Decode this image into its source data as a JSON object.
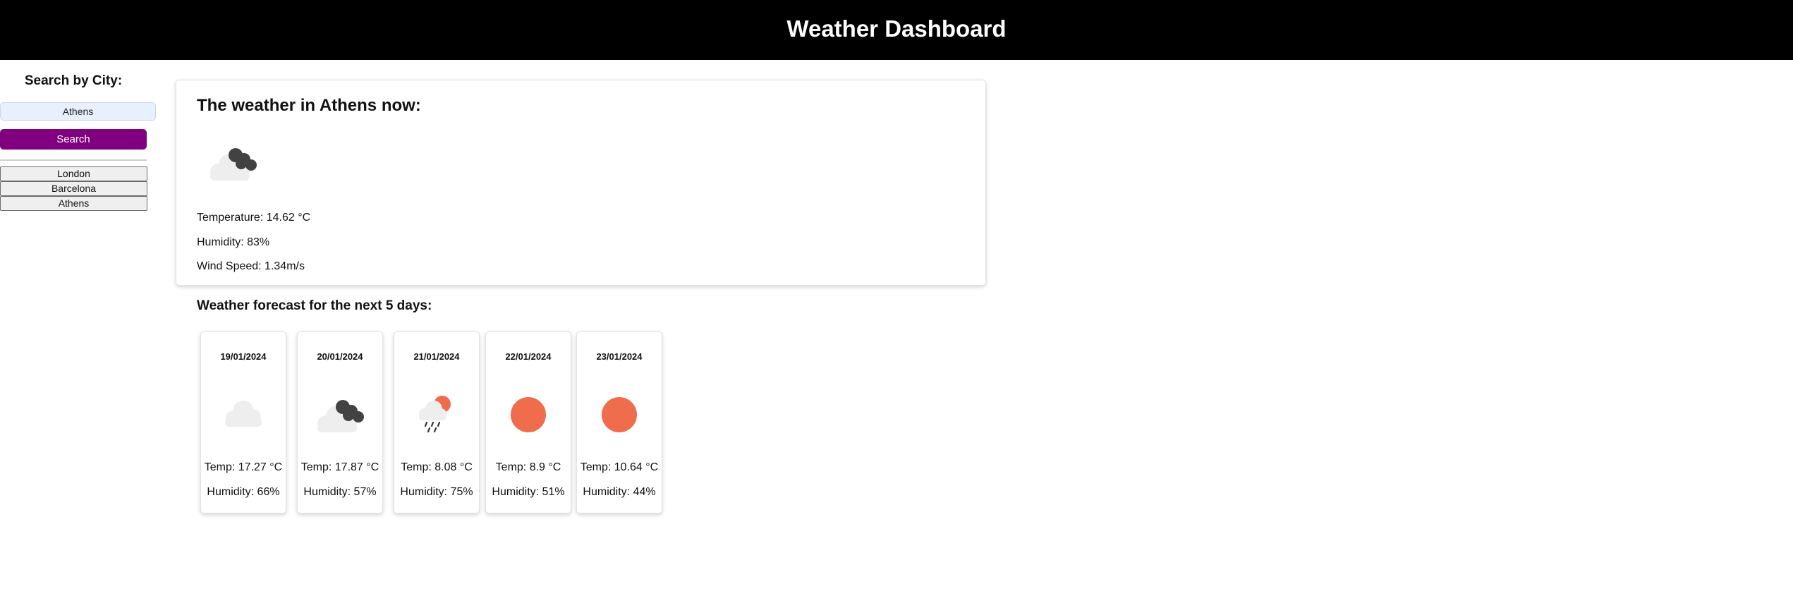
{
  "header": {
    "title": "Weather Dashboard"
  },
  "sidebar": {
    "heading": "Search by City:",
    "search_input_value": "Athens",
    "search_button_label": "Search",
    "history": [
      "London",
      "Barcelona",
      "Athens"
    ]
  },
  "current": {
    "heading": "The weather in Athens now:",
    "icon": "broken-clouds-icon",
    "temperature": "Temperature: 14.62 °C",
    "humidity": "Humidity: 83%",
    "wind": "Wind Speed: 1.34m/s"
  },
  "forecast": {
    "heading": "Weather forecast for the next 5 days:",
    "days": [
      {
        "date": "19/01/2024",
        "icon": "cloud-icon",
        "temp": "Temp: 17.27 °C",
        "humidity": "Humidity: 66%"
      },
      {
        "date": "20/01/2024",
        "icon": "broken-clouds-icon",
        "temp": "Temp: 17.87 °C",
        "humidity": "Humidity: 57%"
      },
      {
        "date": "21/01/2024",
        "icon": "rain-sun-icon",
        "temp": "Temp: 8.08 °C",
        "humidity": "Humidity: 75%"
      },
      {
        "date": "22/01/2024",
        "icon": "sun-icon",
        "temp": "Temp: 8.9 °C",
        "humidity": "Humidity: 51%"
      },
      {
        "date": "23/01/2024",
        "icon": "sun-icon",
        "temp": "Temp: 10.64 °C",
        "humidity": "Humidity: 44%"
      }
    ]
  },
  "colors": {
    "header_bg": "#000000",
    "search_button": "#800080",
    "sun": "#ef6c4d",
    "dark_cloud": "#424242",
    "light_cloud": "#eeeeee"
  }
}
